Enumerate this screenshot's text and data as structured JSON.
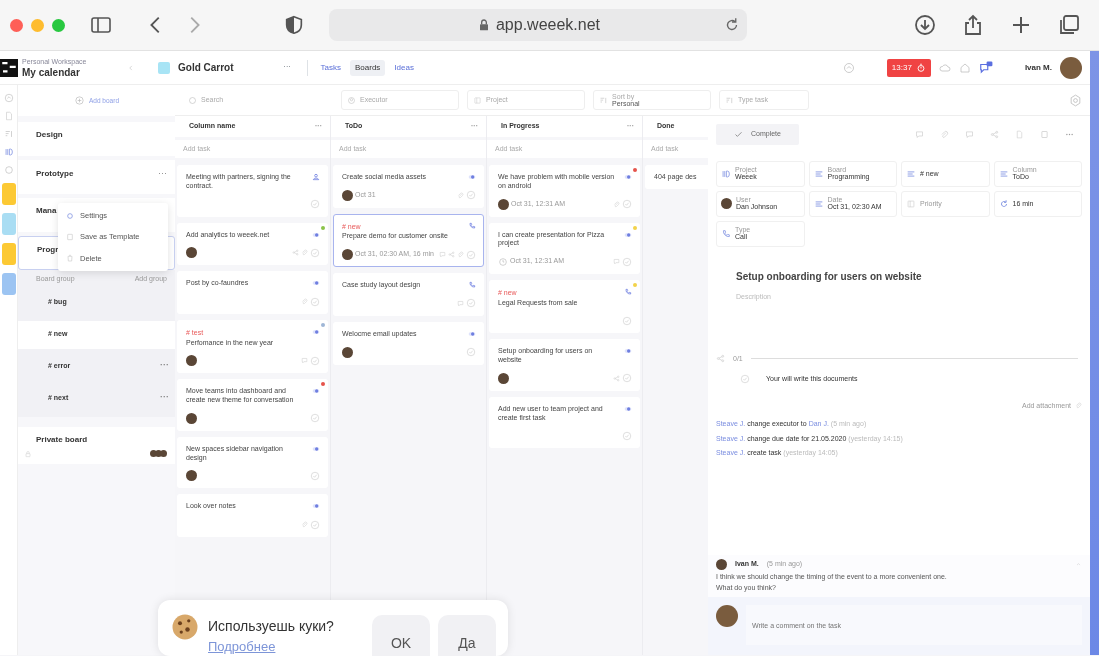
{
  "browser": {
    "url": "app.weeek.net"
  },
  "header": {
    "workspace_label": "Personal Workspace",
    "workspace": "My calendar",
    "project": {
      "name": "Gold Carrot",
      "color": "#a8e4f5"
    },
    "more": "···",
    "tabs": [
      {
        "label": "Tasks",
        "selected": false
      },
      {
        "label": "Boards",
        "selected": true
      },
      {
        "label": "Ideas",
        "selected": false
      }
    ],
    "timer": "13:37",
    "user": "Ivan M."
  },
  "rail_projects": [
    {
      "color": "#fcc934"
    },
    {
      "color": "#a9ddf3"
    },
    {
      "color": "#fcc934"
    },
    {
      "color": "#9cc4f2"
    }
  ],
  "sidebar": {
    "add_board": "Add board",
    "boards": [
      {
        "name": "Design",
        "selected": false
      },
      {
        "name": "Prototype",
        "selected": false,
        "more": "···"
      },
      {
        "name": "Mana",
        "selected": false
      },
      {
        "name": "Progr",
        "selected": true,
        "group_label": "Board group",
        "add_group": "Add group",
        "groups": [
          {
            "name": "# bug",
            "selected": false
          },
          {
            "name": "# new",
            "selected": true
          },
          {
            "name": "# error",
            "selected": false,
            "more": "···"
          },
          {
            "name": "# next",
            "selected": false,
            "more": "···"
          }
        ]
      },
      {
        "name": "Private board",
        "selected": false,
        "private": true
      }
    ],
    "menu": [
      {
        "label": "Settings",
        "kind": "settings"
      },
      {
        "label": "Save as Template",
        "kind": "template"
      },
      {
        "label": "Delete",
        "kind": "delete"
      }
    ]
  },
  "filters": {
    "search": {
      "placeholder": "Search"
    },
    "executor": {
      "placeholder": "Executor"
    },
    "project": {
      "placeholder": "Project"
    },
    "sort": {
      "label": "Sort by",
      "value": "Personal"
    },
    "type": {
      "placeholder": "Type task"
    }
  },
  "columns": [
    {
      "name": "Column name",
      "more": "···",
      "add_task": "Add task",
      "cards": [
        {
          "title": "Meeting with partners, signing the contract.",
          "kind": "meeting",
          "selected": false,
          "check": true
        },
        {
          "title": "Add analytics to weeek.net",
          "kind": "task",
          "selected": false,
          "avatar": true,
          "shared": true,
          "files": true,
          "check": true,
          "color": "#8bc34a"
        },
        {
          "title": "Post by co-faundres",
          "kind": "task",
          "selected": false,
          "files": true,
          "check": true
        },
        {
          "tag": "# test",
          "title": "Perfomance in the new year",
          "kind": "task",
          "selected": false,
          "avatar": true,
          "comments": true,
          "check": true,
          "color": "#9fb6d6"
        },
        {
          "title": "Move teams into dashboard and create new theme for conversation",
          "kind": "task",
          "selected": false,
          "avatar": true,
          "check": true,
          "color": "#e5534b"
        },
        {
          "title": "New spaces sidebar navigation design",
          "kind": "task",
          "selected": false,
          "avatar": true,
          "check": true
        },
        {
          "title": "Look over notes",
          "kind": "task",
          "selected": false,
          "files": true,
          "check": true
        }
      ]
    },
    {
      "name": "ToDo",
      "more": "···",
      "add_task": "Add task",
      "cards": [
        {
          "title": "Create social media assets",
          "kind": "task",
          "selected": false,
          "avatar": true,
          "date": "Oct 31",
          "files": true,
          "check": true
        },
        {
          "tag": "# new",
          "title": "Prepare demo for customer onsite",
          "kind": "call",
          "selected": true,
          "avatar": true,
          "date": "Oct 31, 02:30 AM, 16 min",
          "comments": true,
          "shared": true,
          "files": true,
          "check": true
        },
        {
          "title": "Case study layout design",
          "kind": "call",
          "selected": false,
          "comments": true,
          "check": true
        },
        {
          "title": "Welocme email updates",
          "kind": "task",
          "selected": false,
          "avatar": true,
          "check": true
        }
      ]
    },
    {
      "name": "In Progress",
      "more": "···",
      "add_task": "Add task",
      "cards": [
        {
          "title": "We have problem with mobile version on android",
          "kind": "task",
          "selected": false,
          "avatar": true,
          "date": "Oct 31, 12:31 AM",
          "files": true,
          "check": true,
          "color": "#e5534b"
        },
        {
          "title": "I can create presentation for Pizza project",
          "kind": "task",
          "selected": false,
          "date": "Oct 31, 12:31 AM",
          "comments": true,
          "check": true,
          "color": "#f3d34a",
          "clock": true
        },
        {
          "tag": "# new",
          "title": "Legal Requests from sale",
          "kind": "call",
          "selected": false,
          "check": true,
          "color": "#f3d34a"
        },
        {
          "title": "Setup onboarding for users on website",
          "kind": "task",
          "selected": false,
          "avatar": true,
          "shared": true,
          "check": true
        },
        {
          "title": "Add new user to team project and create first task",
          "kind": "task",
          "selected": false,
          "check": true
        }
      ]
    },
    {
      "name": "Done",
      "add_task": "Add task",
      "cards": [
        {
          "title": "404 page des",
          "kind": "plain",
          "selected": false,
          "check": false
        }
      ]
    }
  ],
  "detail": {
    "complete": "Complete",
    "fields": [
      {
        "label": "Project",
        "value": "Weeek",
        "kind": "board"
      },
      {
        "label": "Board",
        "value": "Programming",
        "kind": "list"
      },
      {
        "value": "# new",
        "kind": "list"
      },
      {
        "label": "Column",
        "value": "ToDo",
        "kind": "list"
      },
      {
        "label": "User",
        "value": "Dan Johnson",
        "kind": "user"
      },
      {
        "label": "Date",
        "value": "Oct 31, 02:30 AM",
        "kind": "list"
      },
      {
        "placeholder": "Priority",
        "kind": "board"
      },
      {
        "value": "16 min",
        "kind": "timer"
      },
      {
        "label": "Type",
        "value": "Call",
        "kind": "call"
      }
    ],
    "title": "Setup onboarding for users on website",
    "description": {
      "placeholder": "Description"
    },
    "checklist": {
      "count": "0/1",
      "level": 0,
      "items": [
        {
          "text": "Your will write this documents",
          "checked": false
        }
      ]
    },
    "add_attachment": "Add attachment",
    "activity": [
      {
        "user": "Steave J.",
        "action": "change executor to",
        "target": "Dan J.",
        "time": "(5 min ago)"
      },
      {
        "user": "Steave J.",
        "action": "change due date for 21.05.2020",
        "time": "(yesterday 14:15)"
      },
      {
        "user": "Steave J.",
        "action": "create task",
        "time": "(yesterday 14:05)"
      }
    ],
    "comment": {
      "author": "Ivan M.",
      "time": "(5 min ago)",
      "lines": [
        "I think we should change the timing of the event to a more convenient one.",
        "What do you think?"
      ]
    },
    "comment_input": {
      "placeholder": "Write a comment on the task"
    }
  },
  "cookie": {
    "question": "Используешь куки?",
    "link": "Подробнее",
    "buttons": [
      "OK",
      "Да"
    ]
  }
}
